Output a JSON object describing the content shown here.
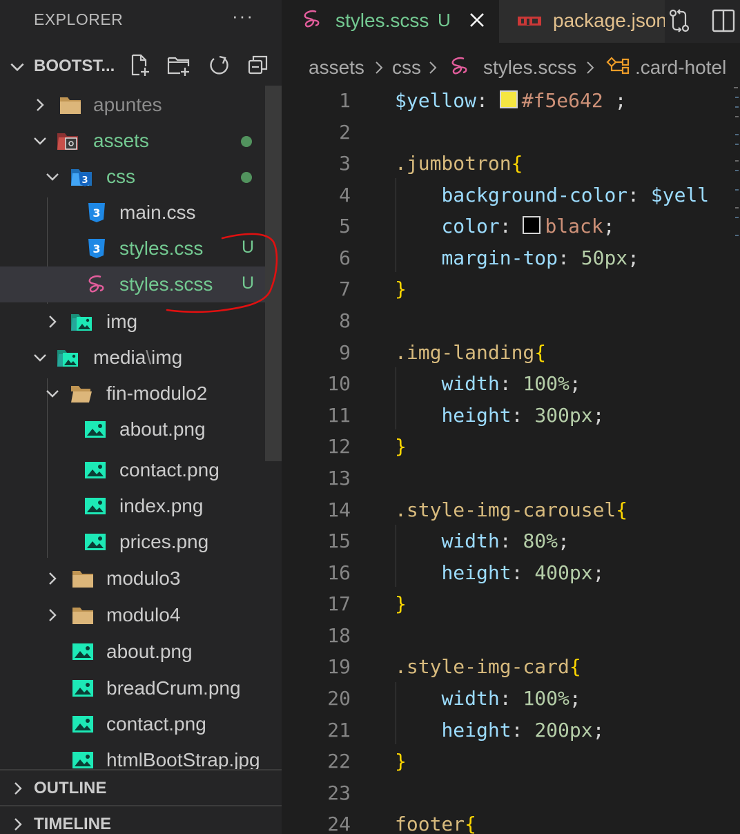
{
  "explorer": {
    "title": "EXPLORER",
    "more": "···",
    "project": "BOOTST...",
    "actions": [
      "new-file-icon",
      "new-folder-icon",
      "refresh-icon",
      "collapse-all-icon"
    ]
  },
  "tree": {
    "apuntes": "apuntes",
    "assets": "assets",
    "css": "css",
    "main_css": "main.css",
    "styles_css": "styles.css",
    "styles_css_badge": "U",
    "styles_scss": "styles.scss",
    "styles_scss_badge": "U",
    "img": "img",
    "media_img_a": "media",
    "media_img_sep": "\\",
    "media_img_b": "img",
    "fin_modulo2": "fin-modulo2",
    "about_png": "about.png",
    "contact_png": "contact.png",
    "index_png": "index.png",
    "prices_png": "prices.png",
    "modulo3": "modulo3",
    "modulo4": "modulo4",
    "about_png_2": "about.png",
    "breadcrum_png": "breadCrum.png",
    "contact_png_2": "contact.png",
    "htmlbootstrap_jpg": "htmlBootStrap.jpg"
  },
  "panels": {
    "outline": "OUTLINE",
    "timeline": "TIMELINE"
  },
  "tabs": {
    "active_label": "styles.scss",
    "active_badge": "U",
    "inactive_label": "package.json"
  },
  "breadcrumb": {
    "part1": "assets",
    "part2": "css",
    "part3": "styles.scss",
    "part4": ".card-hotel"
  },
  "code": {
    "line_numbers": [
      "1",
      "2",
      "3",
      "4",
      "5",
      "6",
      "7",
      "8",
      "9",
      "10",
      "11",
      "12",
      "13",
      "14",
      "15",
      "16",
      "17",
      "18",
      "19",
      "20",
      "21",
      "22",
      "23",
      "24"
    ],
    "l1_var": "$yellow",
    "l1_colon": ":",
    "l1_value": "#f5e642",
    "l1_end": " ;",
    "l3_sel": ".jumbotron",
    "l3_brace": "{",
    "l4_prop": "background-color",
    "l4_colon": ": ",
    "l4_value": "$yell",
    "l5_prop": "color",
    "l5_colon": ": ",
    "l5_value": "black",
    "l5_end": ";",
    "l6_prop": "margin-top",
    "l6_colon": ": ",
    "l6_value": "50px",
    "l6_end": ";",
    "l7_brace": "}",
    "l9_sel": ".img-landing",
    "l9_brace": "{",
    "l10_prop": "width",
    "l10_colon": ": ",
    "l10_value": "100%",
    "l10_end": ";",
    "l11_prop": "height",
    "l11_colon": ": ",
    "l11_value": "300px",
    "l11_end": ";",
    "l12_brace": "}",
    "l14_sel": ".style-img-carousel",
    "l14_brace": "{",
    "l15_prop": "width",
    "l15_colon": ": ",
    "l15_value": "80%",
    "l15_end": ";",
    "l16_prop": "height",
    "l16_colon": ": ",
    "l16_value": "400px",
    "l16_end": ";",
    "l17_brace": "}",
    "l19_sel": ".style-img-card",
    "l19_brace": "{",
    "l20_prop": "width",
    "l20_colon": ": ",
    "l20_value": "100%",
    "l20_end": ";",
    "l21_prop": "height",
    "l21_colon": ": ",
    "l21_value": "200px",
    "l21_end": ";",
    "l22_brace": "}",
    "l24_sel": "footer",
    "l24_brace": "{"
  },
  "colors": {
    "yellow_swatch": "#f5e642",
    "black_swatch": "#000000",
    "git_untracked": "#73c991",
    "annotation_red": "#e01010"
  }
}
